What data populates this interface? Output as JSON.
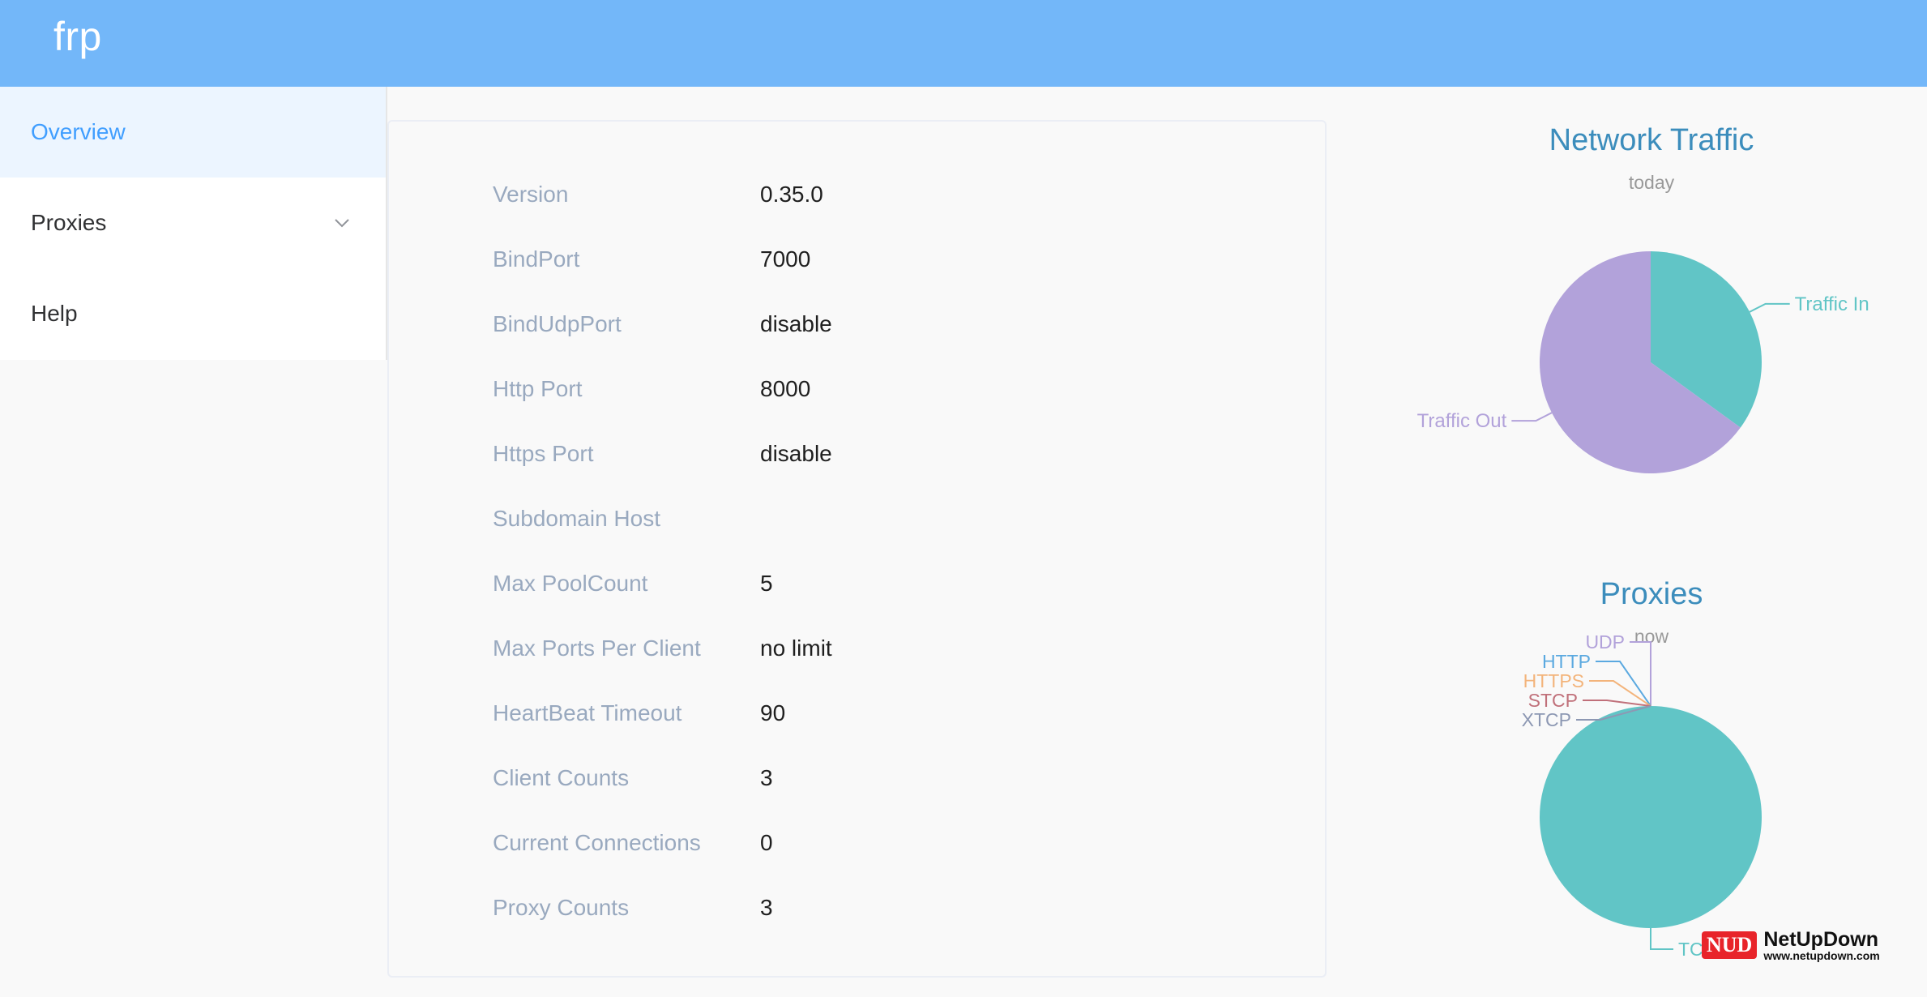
{
  "header": {
    "brand": "frp"
  },
  "sidebar": {
    "items": [
      {
        "label": "Overview"
      },
      {
        "label": "Proxies"
      },
      {
        "label": "Help"
      }
    ]
  },
  "overview": {
    "rows": [
      {
        "label": "Version",
        "value": "0.35.0"
      },
      {
        "label": "BindPort",
        "value": "7000"
      },
      {
        "label": "BindUdpPort",
        "value": "disable"
      },
      {
        "label": "Http Port",
        "value": "8000"
      },
      {
        "label": "Https Port",
        "value": "disable"
      },
      {
        "label": "Subdomain Host",
        "value": ""
      },
      {
        "label": "Max PoolCount",
        "value": "5"
      },
      {
        "label": "Max Ports Per Client",
        "value": "no limit"
      },
      {
        "label": "HeartBeat Timeout",
        "value": "90"
      },
      {
        "label": "Client Counts",
        "value": "3"
      },
      {
        "label": "Current Connections",
        "value": "0"
      },
      {
        "label": "Proxy Counts",
        "value": "3"
      }
    ]
  },
  "chart_data": [
    {
      "type": "pie",
      "title": "Network Traffic",
      "subtitle": "today",
      "slices": [
        {
          "name": "Traffic In",
          "value": 35,
          "color": "#61c5c6"
        },
        {
          "name": "Traffic Out",
          "value": 65,
          "color": "#b2a2da"
        }
      ]
    },
    {
      "type": "pie",
      "title": "Proxies",
      "subtitle": "now",
      "slices": [
        {
          "name": "TCP",
          "value": 3,
          "color": "#61c5c6"
        },
        {
          "name": "UDP",
          "value": 0,
          "color": "#b2a2da"
        },
        {
          "name": "HTTP",
          "value": 0,
          "color": "#5ba9e0"
        },
        {
          "name": "HTTPS",
          "value": 0,
          "color": "#f3b47b"
        },
        {
          "name": "STCP",
          "value": 0,
          "color": "#c0707a"
        },
        {
          "name": "XTCP",
          "value": 0,
          "color": "#8d98b3"
        }
      ]
    }
  ],
  "watermark": {
    "badge": "NUD",
    "name": "NetUpDown",
    "url": "www.netupdown.com"
  }
}
